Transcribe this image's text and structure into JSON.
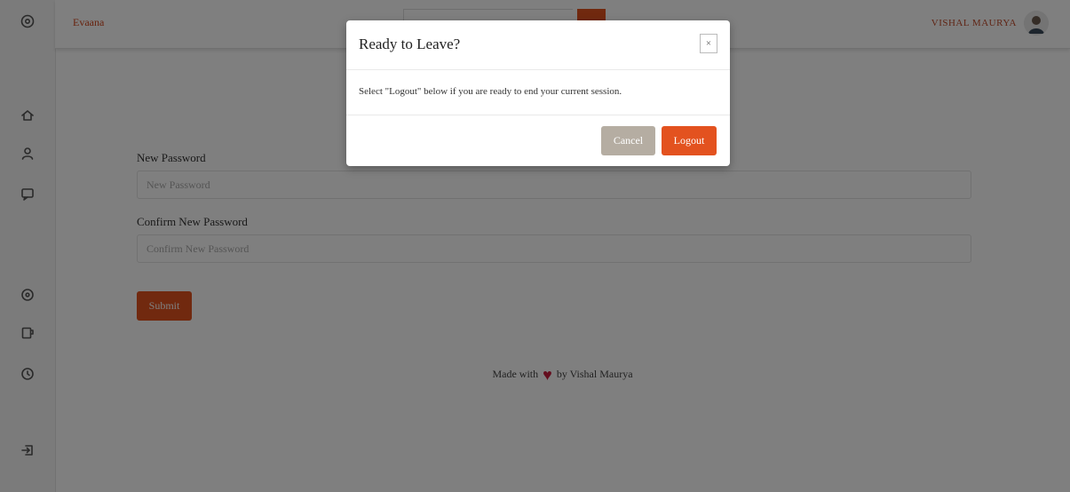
{
  "topbar": {
    "brand": "Evaana",
    "user_name": "VISHAL MAURYA"
  },
  "sidebar": {
    "icons": [
      "dashboard-icon",
      "home-icon",
      "user-icon",
      "message-icon",
      "target-icon",
      "notes-icon",
      "clock-icon",
      "logout-icon"
    ]
  },
  "form": {
    "new_password_label": "New Password",
    "new_password_placeholder": "New Password",
    "confirm_password_label": "Confirm New Password",
    "confirm_password_placeholder": "Confirm New Password",
    "submit_label": "Submit"
  },
  "footer": {
    "prefix": "Made with",
    "suffix": "by Vishal Maurya"
  },
  "modal": {
    "title": "Ready to Leave?",
    "close_symbol": "×",
    "body": "Select \"Logout\" below if you are ready to end your current session.",
    "cancel_label": "Cancel",
    "logout_label": "Logout"
  },
  "colors": {
    "accent": "#e3521f",
    "cancel": "#b5ada2",
    "heart": "#c81d3c"
  }
}
